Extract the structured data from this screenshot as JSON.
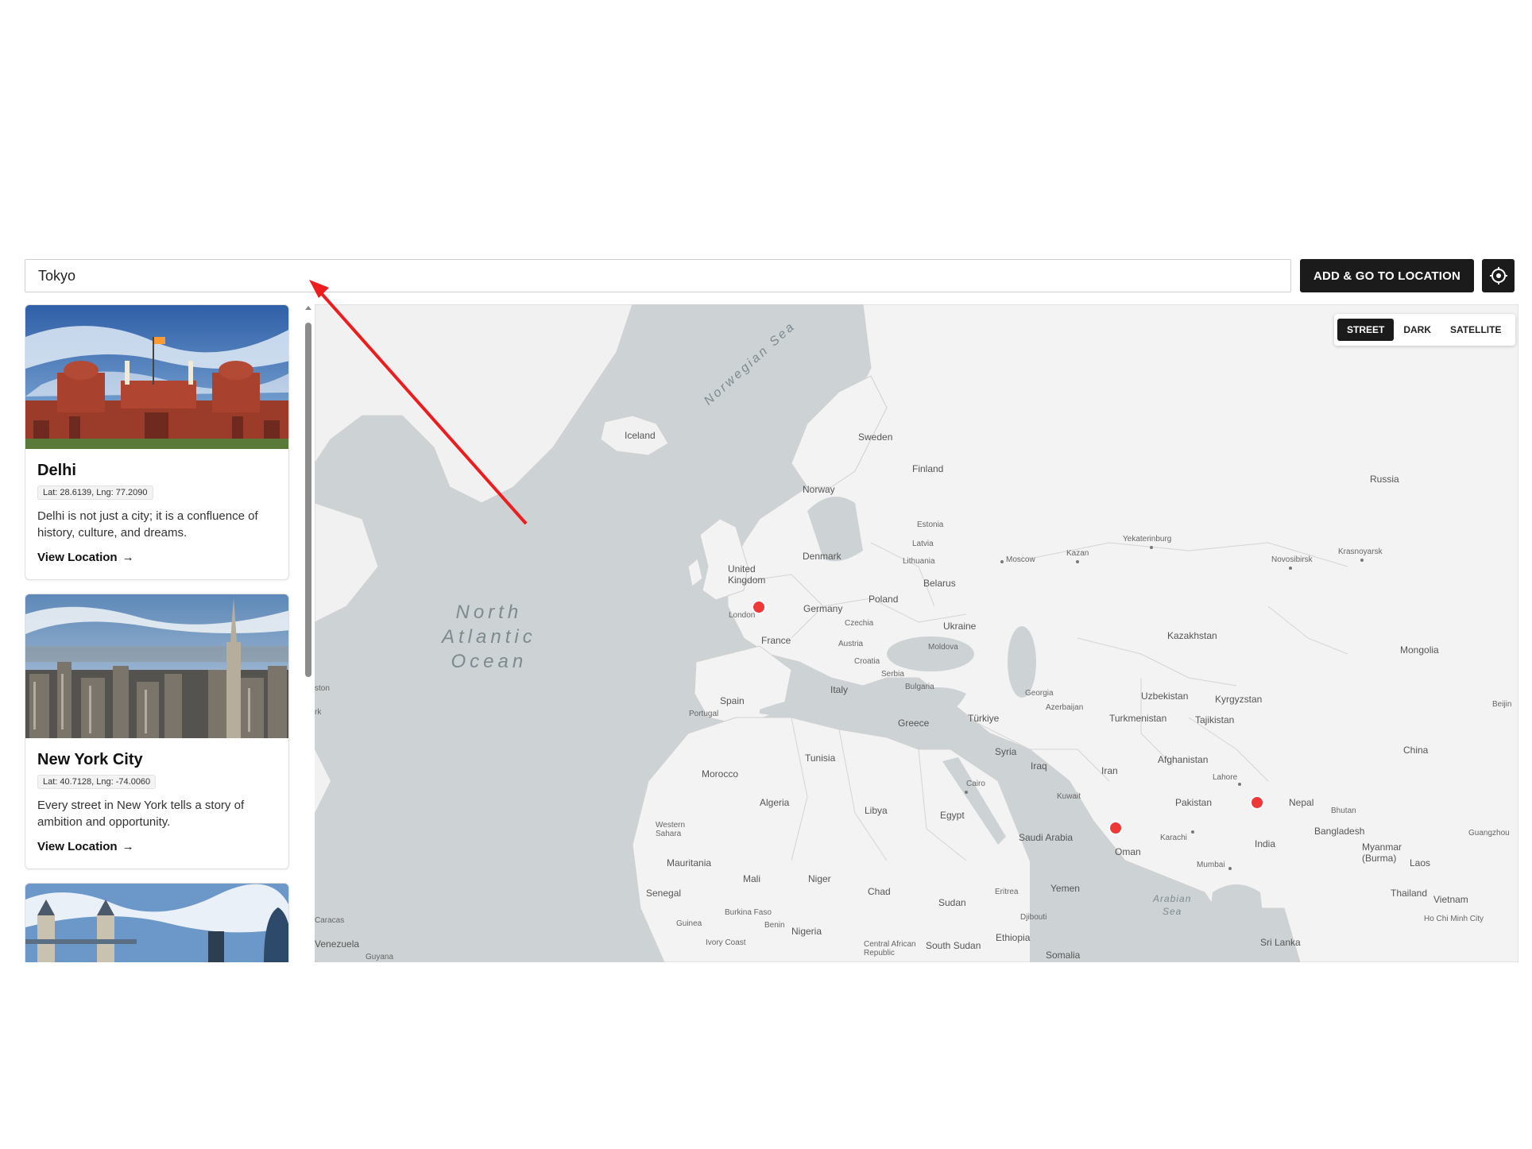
{
  "search": {
    "value": "Tokyo"
  },
  "actions": {
    "add_label": "ADD & GO TO LOCATION",
    "locate_icon": "crosshair-locate-icon"
  },
  "locations": [
    {
      "name": "Delhi",
      "coords": "Lat: 28.6139, Lng: 77.2090",
      "description": "Delhi is not just a city; it is a confluence of history, culture, and dreams.",
      "link": "View Location",
      "image_icon": "red-fort-photo"
    },
    {
      "name": "New York City",
      "coords": "Lat: 40.7128, Lng: -74.0060",
      "description": "Every street in New York tells a story of ambition and opportunity.",
      "link": "View Location",
      "image_icon": "manhattan-skyline-photo"
    },
    {
      "name": "",
      "image_icon": "tower-bridge-photo"
    }
  ],
  "map": {
    "styles": [
      "STREET",
      "DARK",
      "SATELLITE"
    ],
    "active_style": "STREET",
    "ocean": "North Atlantic Ocean",
    "seas": [
      "Norwegian Sea",
      "Arabian Sea"
    ],
    "countries": [
      "Iceland",
      "Sweden",
      "Finland",
      "Norway",
      "Russia",
      "Estonia",
      "Latvia",
      "Lithuania",
      "Denmark",
      "United Kingdom",
      "Belarus",
      "Poland",
      "Germany",
      "Czechia",
      "Ukraine",
      "France",
      "Austria",
      "Moldova",
      "Croatia",
      "Serbia",
      "Bulgaria",
      "Italy",
      "Spain",
      "Portugal",
      "Greece",
      "Türkiye",
      "Georgia",
      "Azerbaijan",
      "Kazakhstan",
      "Uzbekistan",
      "Kyrgyzstan",
      "Turkmenistan",
      "Tajikistan",
      "Mongolia",
      "Tunisia",
      "Syria",
      "Iraq",
      "Iran",
      "Afghanistan",
      "China",
      "Morocco",
      "Algeria",
      "Libya",
      "Egypt",
      "Pakistan",
      "Nepal",
      "Bhutan",
      "Bangladesh",
      "Western Sahara",
      "Saudi Arabia",
      "Oman",
      "India",
      "Myanmar (Burma)",
      "Laos",
      "Mauritania",
      "Mali",
      "Niger",
      "Chad",
      "Sudan",
      "Eritrea",
      "Yemen",
      "Senegal",
      "Thailand",
      "Vietnam",
      "Guinea",
      "Burkina Faso",
      "Benin",
      "Nigeria",
      "Djibouti",
      "Ivory Coast",
      "Central African Republic",
      "South Sudan",
      "Ethiopia",
      "Somalia",
      "Sri Lanka",
      "Venezuela",
      "Guyana"
    ],
    "cities": [
      "London",
      "Moscow",
      "Kazan",
      "Yekaterinburg",
      "Novosibirsk",
      "Krasnoyarsk",
      "Cairo",
      "Kuwait",
      "Lahore",
      "Karachi",
      "Mumbai",
      "Ho Chi Minh City",
      "Guangzhou",
      "Beijin",
      "Caracas",
      "ston",
      "rk"
    ],
    "marker_color": "#ef3838"
  }
}
